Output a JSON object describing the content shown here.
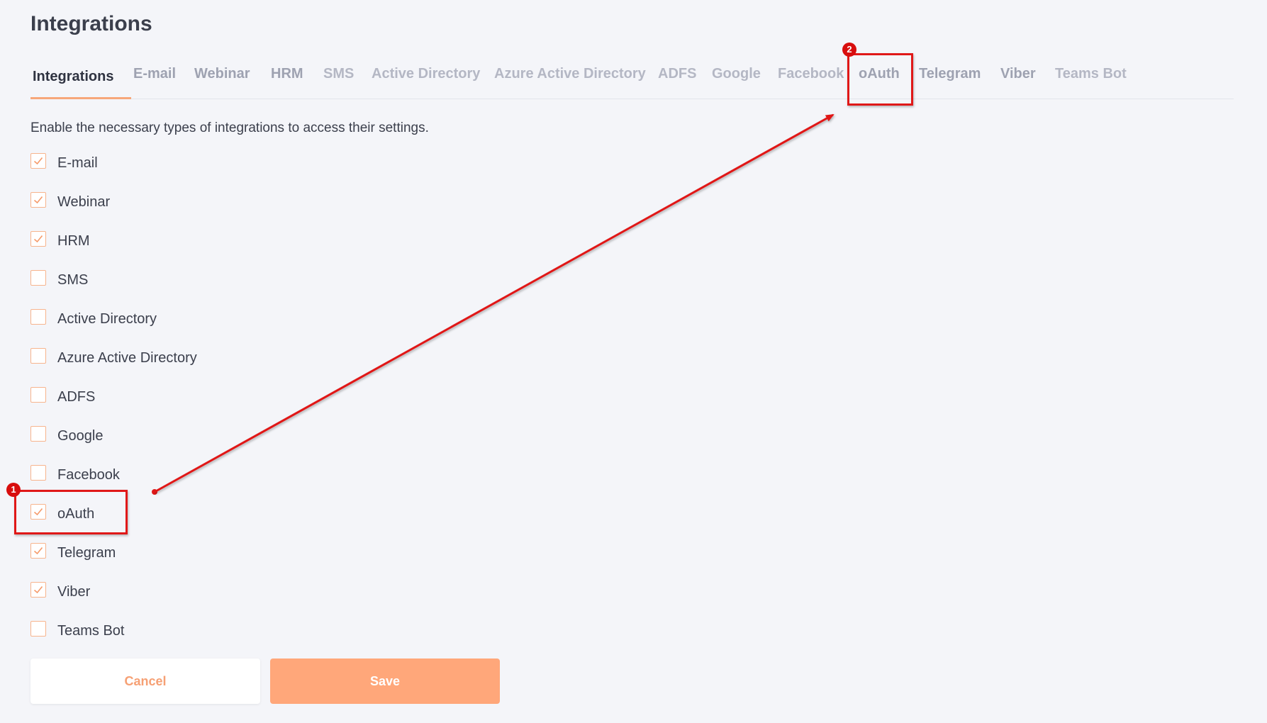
{
  "page": {
    "title": "Integrations",
    "description": "Enable the necessary types of integrations to access their settings."
  },
  "tabs": [
    {
      "label": "Integrations",
      "active": true,
      "enabled": true
    },
    {
      "label": "E-mail",
      "active": false,
      "enabled": true
    },
    {
      "label": "Webinar",
      "active": false,
      "enabled": true
    },
    {
      "label": "HRM",
      "active": false,
      "enabled": true
    },
    {
      "label": "SMS",
      "active": false,
      "enabled": false
    },
    {
      "label": "Active Directory",
      "active": false,
      "enabled": false
    },
    {
      "label": "Azure Active Directory",
      "active": false,
      "enabled": false
    },
    {
      "label": "ADFS",
      "active": false,
      "enabled": false
    },
    {
      "label": "Google",
      "active": false,
      "enabled": false
    },
    {
      "label": "Facebook",
      "active": false,
      "enabled": false
    },
    {
      "label": "oAuth",
      "active": false,
      "enabled": true
    },
    {
      "label": "Telegram",
      "active": false,
      "enabled": true
    },
    {
      "label": "Viber",
      "active": false,
      "enabled": true
    },
    {
      "label": "Teams Bot",
      "active": false,
      "enabled": false
    }
  ],
  "integrations": [
    {
      "label": "E-mail",
      "checked": true
    },
    {
      "label": "Webinar",
      "checked": true
    },
    {
      "label": "HRM",
      "checked": true
    },
    {
      "label": "SMS",
      "checked": false
    },
    {
      "label": "Active Directory",
      "checked": false
    },
    {
      "label": "Azure Active Directory",
      "checked": false
    },
    {
      "label": "ADFS",
      "checked": false
    },
    {
      "label": "Google",
      "checked": false
    },
    {
      "label": "Facebook",
      "checked": false
    },
    {
      "label": "oAuth",
      "checked": true
    },
    {
      "label": "Telegram",
      "checked": true
    },
    {
      "label": "Viber",
      "checked": true
    },
    {
      "label": "Teams Bot",
      "checked": false
    }
  ],
  "buttons": {
    "cancel_label": "Cancel",
    "save_label": "Save"
  },
  "annotations": {
    "badge_1": "1",
    "badge_2": "2",
    "color": "#e01818"
  },
  "colors": {
    "accent": "#ffa77a",
    "checkbox_border": "#f7b48d",
    "background": "#f4f5f9"
  }
}
